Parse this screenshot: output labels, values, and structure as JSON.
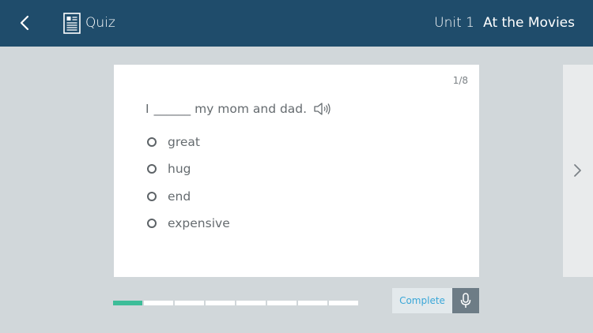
{
  "header": {
    "back_icon": "chevron-left-icon",
    "quiz_icon": "document-icon",
    "quiz_label": "Quiz",
    "unit_label": "Unit 1",
    "lesson_title": "At the Movies"
  },
  "quiz": {
    "counter": "1/8",
    "question_before": "I",
    "question_blank": "______",
    "question_after": "my mom and dad.",
    "audio_icon": "speaker-icon",
    "options": [
      {
        "label": "great"
      },
      {
        "label": "hug"
      },
      {
        "label": "end"
      },
      {
        "label": "expensive"
      }
    ]
  },
  "navigation": {
    "next_icon": "chevron-right-icon"
  },
  "progress": {
    "total_segments": 8,
    "current_segment": 1,
    "active_color": "#3dbd99"
  },
  "footer": {
    "complete_label": "Complete",
    "mic_icon": "microphone-icon"
  },
  "colors": {
    "header_bg": "#1f4c6b",
    "page_bg": "#d1d7da",
    "accent_blue": "#3aa7d8"
  }
}
